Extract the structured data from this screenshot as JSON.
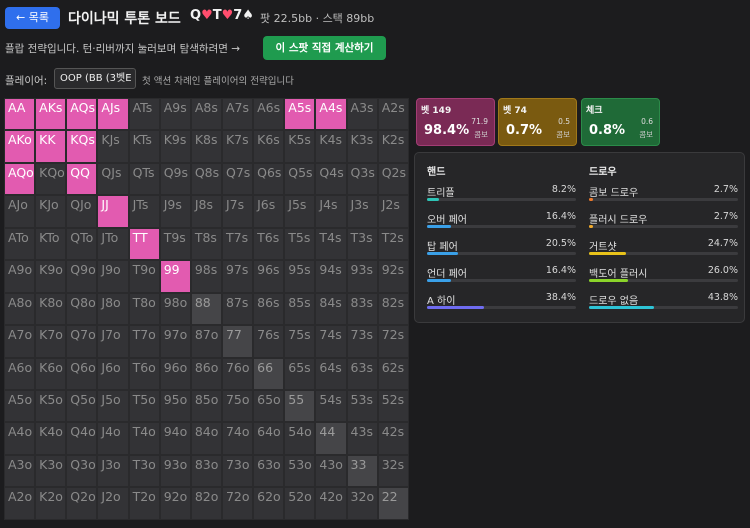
{
  "header": {
    "back_label": "← 목록",
    "title": "다이나믹 투톤 보드",
    "board_cards": [
      {
        "text": "Q",
        "color": "#f2f2f2"
      },
      {
        "text": "♥",
        "color": "#ff4d6d"
      },
      {
        "text": "T",
        "color": "#f2f2f2"
      },
      {
        "text": "♥",
        "color": "#ff4d6d"
      },
      {
        "text": "7",
        "color": "#f2f2f2"
      },
      {
        "text": "♠",
        "color": "#f2f2f2"
      }
    ],
    "pot_stack": "팟 22.5bb · 스택 89bb"
  },
  "intro": {
    "description": "플랍 전략입니다. 턴·리버까지 눌러보며 탐색하려면 →",
    "calc_button": "이 스팟 직접 계산하기"
  },
  "player": {
    "label": "플레이어:",
    "selected": "OOP (BB (3벳E",
    "note": "첫 액션 차례인 플레이어의 전략입니다"
  },
  "range_grid": {
    "rows": [
      [
        "AA",
        "AKs",
        "AQs",
        "AJs",
        "ATs",
        "A9s",
        "A8s",
        "A7s",
        "A6s",
        "A5s",
        "A4s",
        "A3s",
        "A2s"
      ],
      [
        "AKo",
        "KK",
        "KQs",
        "KJs",
        "KTs",
        "K9s",
        "K8s",
        "K7s",
        "K6s",
        "K5s",
        "K4s",
        "K3s",
        "K2s"
      ],
      [
        "AQo",
        "KQo",
        "QQ",
        "QJs",
        "QTs",
        "Q9s",
        "Q8s",
        "Q7s",
        "Q6s",
        "Q5s",
        "Q4s",
        "Q3s",
        "Q2s"
      ],
      [
        "AJo",
        "KJo",
        "QJo",
        "JJ",
        "JTs",
        "J9s",
        "J8s",
        "J7s",
        "J6s",
        "J5s",
        "J4s",
        "J3s",
        "J2s"
      ],
      [
        "ATo",
        "KTo",
        "QTo",
        "JTo",
        "TT",
        "T9s",
        "T8s",
        "T7s",
        "T6s",
        "T5s",
        "T4s",
        "T3s",
        "T2s"
      ],
      [
        "A9o",
        "K9o",
        "Q9o",
        "J9o",
        "T9o",
        "99",
        "98s",
        "97s",
        "96s",
        "95s",
        "94s",
        "93s",
        "92s"
      ],
      [
        "A8o",
        "K8o",
        "Q8o",
        "J8o",
        "T8o",
        "98o",
        "88",
        "87s",
        "86s",
        "85s",
        "84s",
        "83s",
        "82s"
      ],
      [
        "A7o",
        "K7o",
        "Q7o",
        "J7o",
        "T7o",
        "97o",
        "87o",
        "77",
        "76s",
        "75s",
        "74s",
        "73s",
        "72s"
      ],
      [
        "A6o",
        "K6o",
        "Q6o",
        "J6o",
        "T6o",
        "96o",
        "86o",
        "76o",
        "66",
        "65s",
        "64s",
        "63s",
        "62s"
      ],
      [
        "A5o",
        "K5o",
        "Q5o",
        "J5o",
        "T5o",
        "95o",
        "85o",
        "75o",
        "65o",
        "55",
        "54s",
        "53s",
        "52s"
      ],
      [
        "A4o",
        "K4o",
        "Q4o",
        "J4o",
        "T4o",
        "94o",
        "84o",
        "74o",
        "64o",
        "54o",
        "44",
        "43s",
        "42s"
      ],
      [
        "A3o",
        "K3o",
        "Q3o",
        "J3o",
        "T3o",
        "93o",
        "83o",
        "73o",
        "63o",
        "53o",
        "43o",
        "33",
        "32s"
      ],
      [
        "A2o",
        "K2o",
        "Q2o",
        "J2o",
        "T2o",
        "92o",
        "82o",
        "72o",
        "62o",
        "52o",
        "42o",
        "32o",
        "22"
      ]
    ],
    "highlighted": [
      "AA",
      "AKs",
      "AQs",
      "AJs",
      "A5s",
      "A4s",
      "AKo",
      "KK",
      "KQs",
      "AQo",
      "QQ",
      "JJ",
      "TT",
      "99"
    ],
    "highlight_color": "#e25bb0"
  },
  "actions": [
    {
      "name": "벳 149",
      "pct": "98.4%",
      "ev": "71.9",
      "ev_label": "콤보",
      "color": "#7a2a55"
    },
    {
      "name": "벳 74",
      "pct": "0.7%",
      "ev": "0.5",
      "ev_label": "콤보",
      "color": "#7a5a10"
    },
    {
      "name": "체크",
      "pct": "0.8%",
      "ev": "0.6",
      "ev_label": "콤보",
      "color": "#1f6a37"
    }
  ],
  "stats": {
    "hands_title": "핸드",
    "draws_title": "드로우",
    "hands": [
      {
        "label": "트리플",
        "value": "8.2%",
        "fraction": 0.082,
        "color": "#2ec4b6"
      },
      {
        "label": "오버 페어",
        "value": "16.4%",
        "fraction": 0.164,
        "color": "#3aa0e8"
      },
      {
        "label": "탑 페어",
        "value": "20.5%",
        "fraction": 0.205,
        "color": "#3aa0e8"
      },
      {
        "label": "언더 페어",
        "value": "16.4%",
        "fraction": 0.164,
        "color": "#3aa0e8"
      },
      {
        "label": "A 하이",
        "value": "38.4%",
        "fraction": 0.384,
        "color": "#6f6cf0"
      }
    ],
    "draws": [
      {
        "label": "콤보 드로우",
        "value": "2.7%",
        "fraction": 0.027,
        "color": "#f07a2a"
      },
      {
        "label": "플러시 드로우",
        "value": "2.7%",
        "fraction": 0.027,
        "color": "#f0a92a"
      },
      {
        "label": "거트샷",
        "value": "24.7%",
        "fraction": 0.247,
        "color": "#e8c21a"
      },
      {
        "label": "백도어 플러시",
        "value": "26.0%",
        "fraction": 0.26,
        "color": "#8bd42a"
      },
      {
        "label": "드로우 없음",
        "value": "43.8%",
        "fraction": 0.438,
        "color": "#2ec4d6"
      }
    ]
  }
}
